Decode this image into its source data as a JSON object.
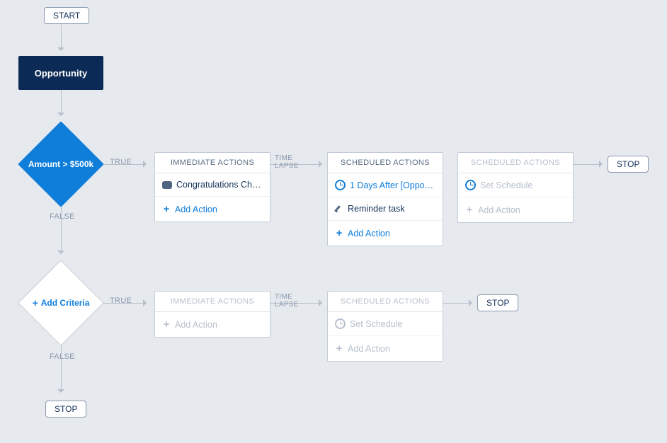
{
  "start": {
    "label": "START"
  },
  "trigger": {
    "label": "Opportunity"
  },
  "criteria1": {
    "label": "Amount > $500k"
  },
  "criteria2": {
    "label": "Add Criteria"
  },
  "edges": {
    "true": "TRUE",
    "false": "FALSE",
    "time_lapse_line1": "TIME",
    "time_lapse_line2": "LAPSE"
  },
  "row1": {
    "immediate": {
      "header": "IMMEDIATE ACTIONS",
      "item1": "Congratulations Ch…",
      "add": "Add Action"
    },
    "scheduled1": {
      "header": "SCHEDULED ACTIONS",
      "schedule": "1 Days After [Oppo…",
      "item1": "Reminder task",
      "add": "Add Action"
    },
    "scheduled2": {
      "header": "SCHEDULED ACTIONS",
      "schedule": "Set Schedule",
      "add": "Add Action"
    },
    "stop": "STOP"
  },
  "row2": {
    "immediate": {
      "header": "IMMEDIATE ACTIONS",
      "add": "Add Action"
    },
    "scheduled": {
      "header": "SCHEDULED ACTIONS",
      "schedule": "Set Schedule",
      "add": "Add Action"
    },
    "stop": "STOP"
  },
  "final_stop": "STOP"
}
